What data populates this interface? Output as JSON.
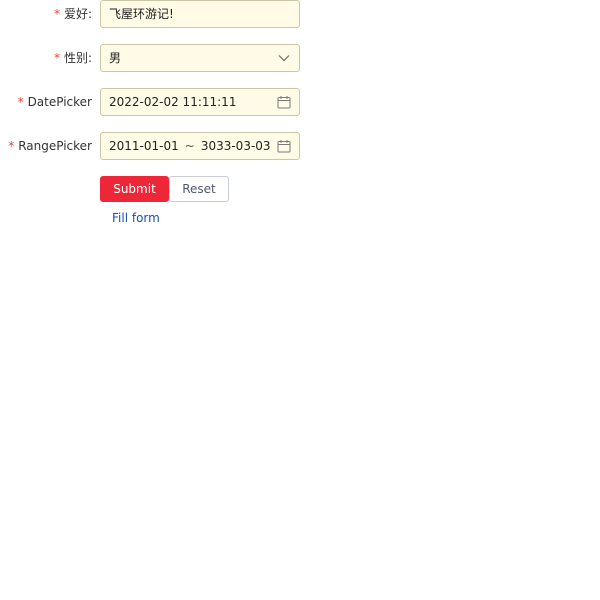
{
  "form": {
    "hobby": {
      "required_mark": "*",
      "label": "爱好:",
      "value": "飞屋环游记!"
    },
    "gender": {
      "required_mark": "*",
      "label": "性别:",
      "value": "男",
      "icon": "chevron-down-icon"
    },
    "date_picker": {
      "required_mark": "*",
      "label": "DatePicker",
      "value": "2022-02-02 11:11:11",
      "icon": "calendar-icon"
    },
    "range_picker": {
      "required_mark": "*",
      "label": "RangePicker",
      "start": "2011-01-01",
      "separator": "~",
      "end": "3033-03-03",
      "icon": "calendar-icon"
    },
    "actions": {
      "submit_label": "Submit",
      "reset_label": "Reset",
      "fill_label": "Fill form"
    }
  },
  "colors": {
    "required": "#f53f3f",
    "field_bg": "#fffbe6",
    "primary": "#ee2738",
    "link": "#1a4fb5"
  }
}
